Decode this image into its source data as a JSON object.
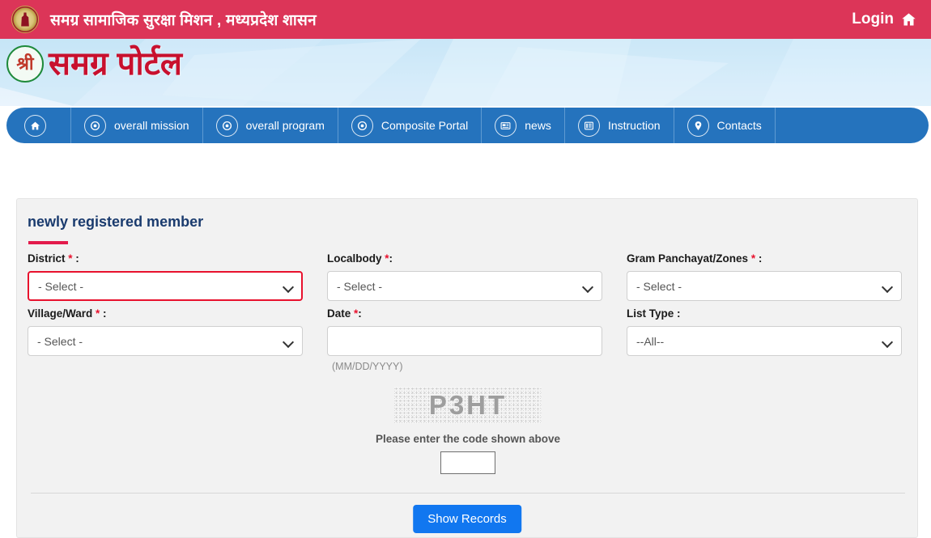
{
  "topbar": {
    "title": "समग्र सामाजिक सुरक्षा मिशन , मध्यप्रदेश शासन",
    "login_label": "Login",
    "emblem_name": "mp-government-emblem",
    "bar_color": "#dc3558"
  },
  "banner": {
    "seal_text": "श्री",
    "brand_text": "समग्र पोर्टल",
    "brand_color": "#c8102e"
  },
  "nav": {
    "bg_color": "#2573bd",
    "items": [
      {
        "label": "",
        "icon": "home-icon"
      },
      {
        "label": "overall mission",
        "icon": "target-icon"
      },
      {
        "label": "overall program",
        "icon": "target-icon"
      },
      {
        "label": "Composite Portal",
        "icon": "target-icon"
      },
      {
        "label": "news",
        "icon": "newspaper-icon"
      },
      {
        "label": "Instruction",
        "icon": "list-icon"
      },
      {
        "label": "Contacts",
        "icon": "location-pin-icon"
      }
    ]
  },
  "card": {
    "title": "newly registered member",
    "title_color": "#1a3b6e",
    "rule_color": "#e31b4c",
    "fields": [
      {
        "label": "District",
        "required": true,
        "label_suffix": " :",
        "type": "select",
        "value": "- Select -",
        "invalid": true
      },
      {
        "label": "Localbody",
        "required": true,
        "label_suffix": ":",
        "type": "select",
        "value": "- Select -",
        "invalid": false
      },
      {
        "label": "Gram Panchayat/Zones",
        "required": true,
        "label_suffix": " :",
        "type": "select",
        "value": "- Select -",
        "invalid": false
      },
      {
        "label": "Village/Ward",
        "required": true,
        "label_suffix": " :",
        "type": "select",
        "value": "- Select -",
        "invalid": false
      },
      {
        "label": "Date",
        "required": true,
        "label_suffix": ":",
        "type": "text",
        "value": "",
        "placeholder": "",
        "hint": "(MM/DD/YYYY)",
        "invalid": false
      },
      {
        "label": "List Type",
        "required": false,
        "label_suffix": " :",
        "type": "select",
        "value": "--All--",
        "invalid": false
      }
    ],
    "captcha": {
      "code": "P3HT",
      "prompt": "Please enter the code shown above",
      "input_value": ""
    },
    "submit_label": "Show Records",
    "submit_color": "#1177f0"
  }
}
